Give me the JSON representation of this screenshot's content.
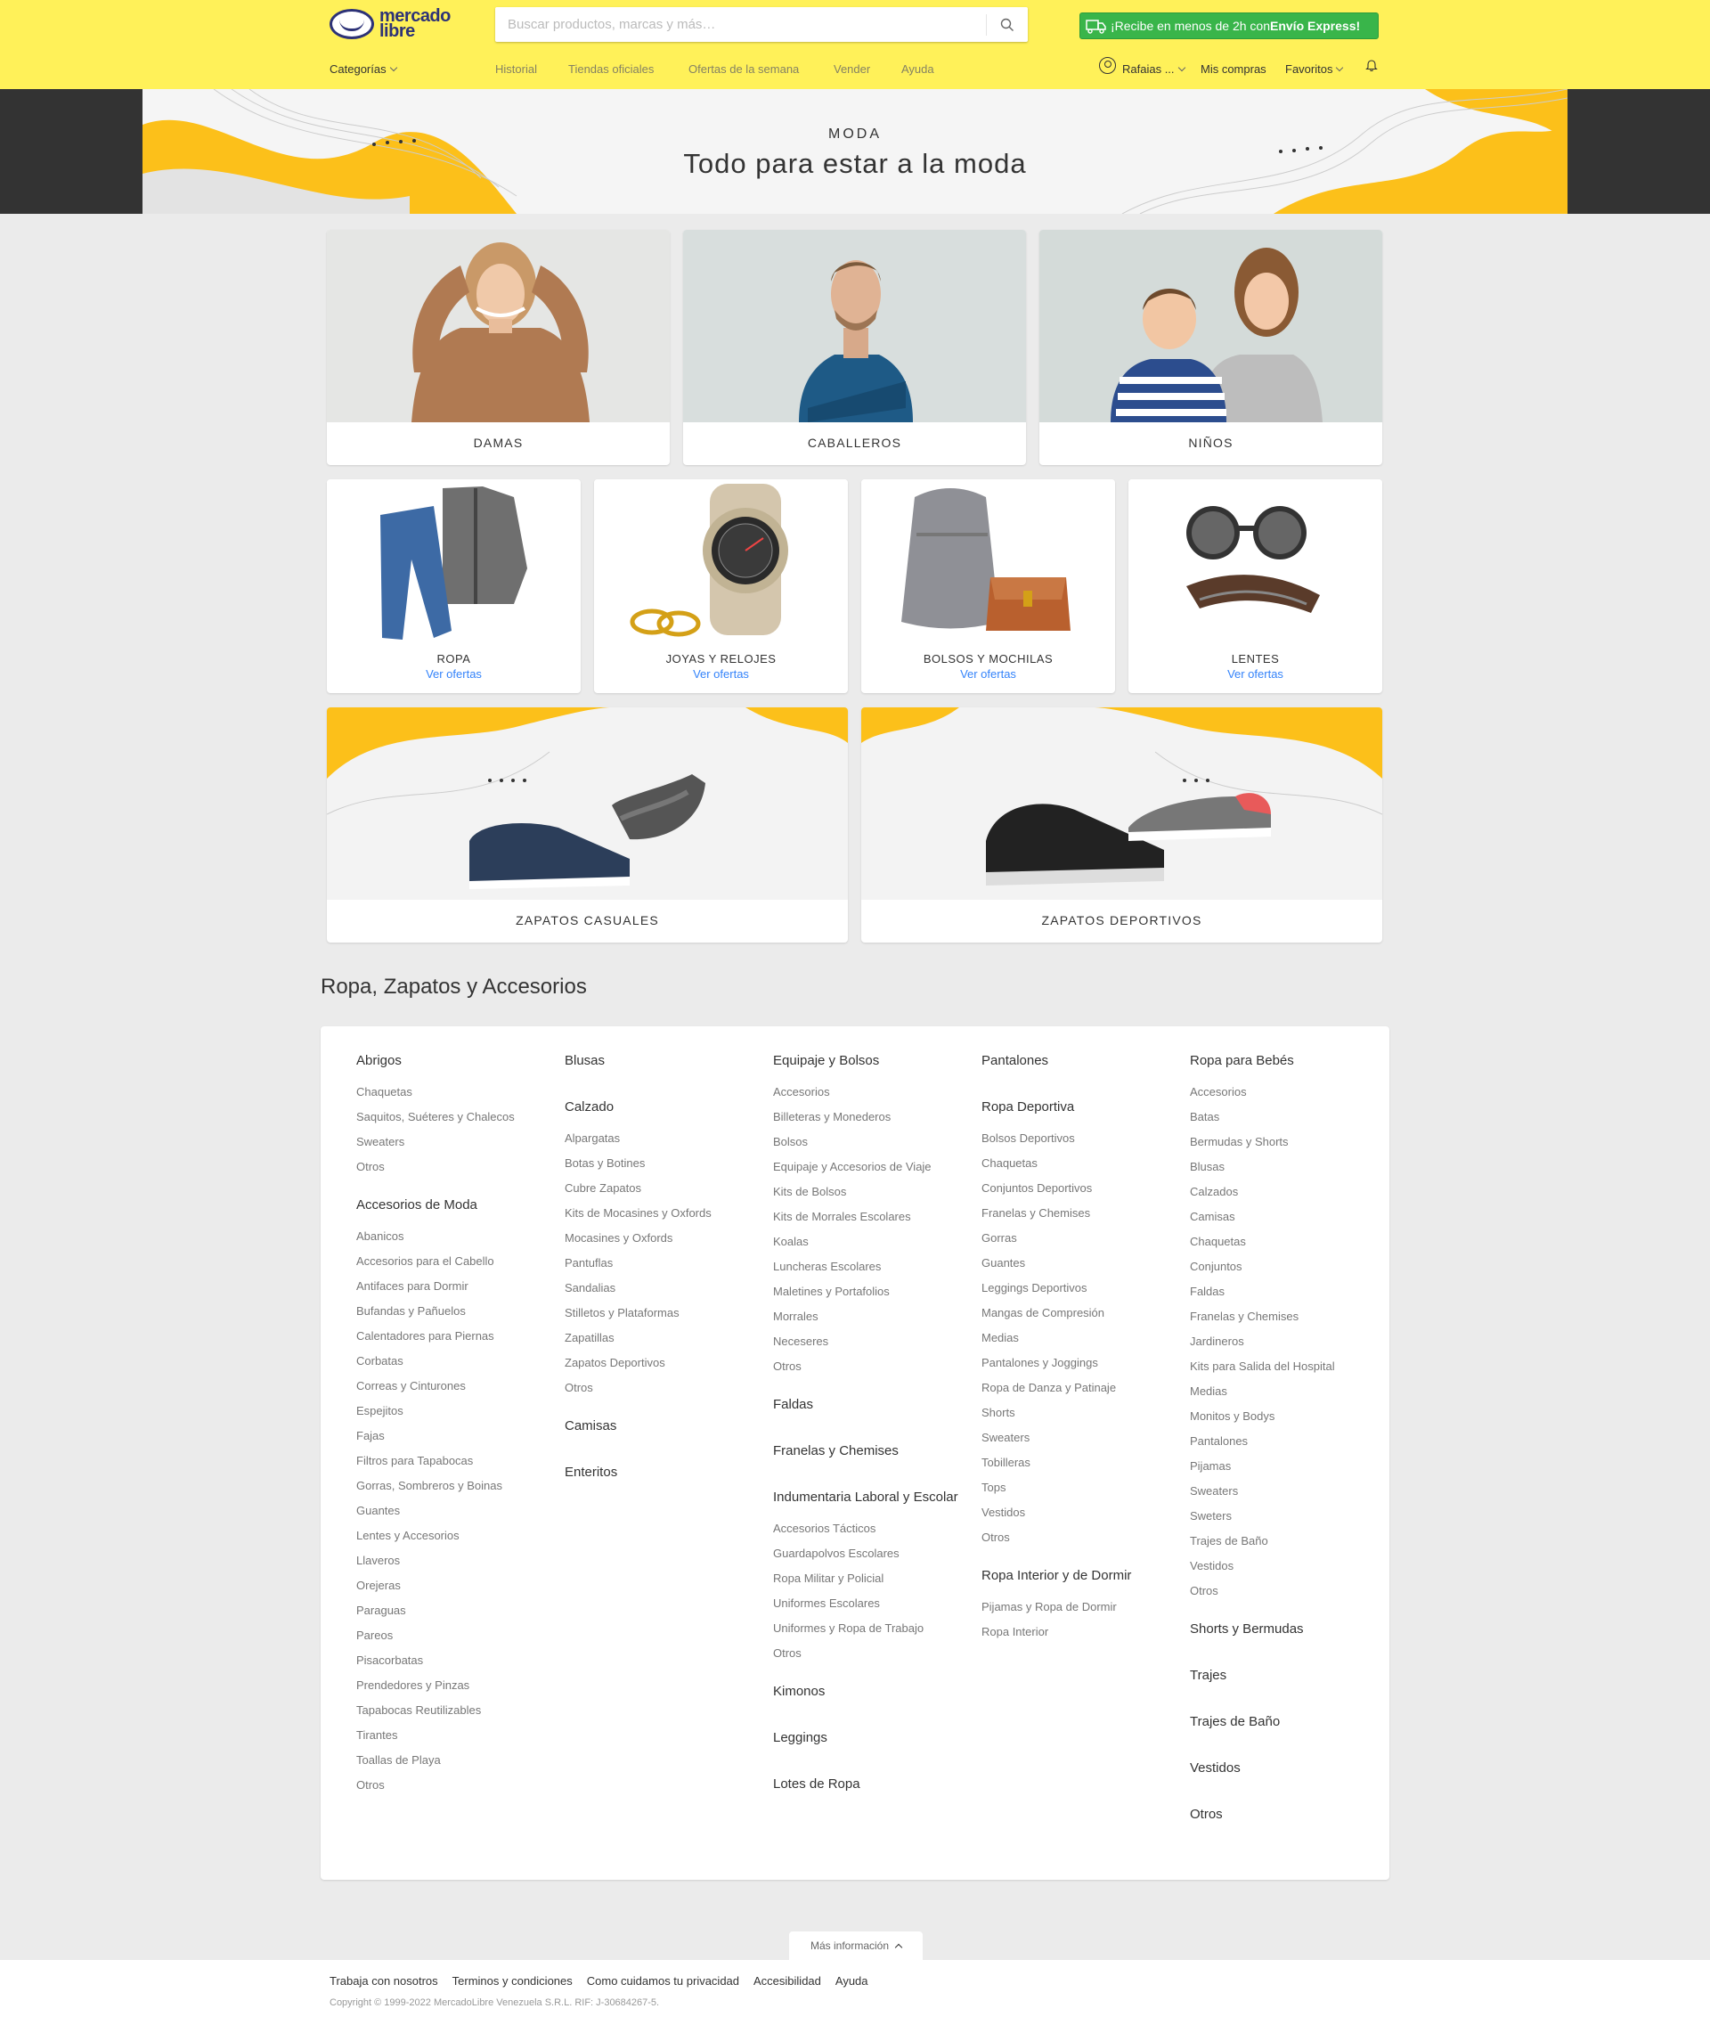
{
  "header": {
    "logo_line1": "mercado",
    "logo_line2": "libre",
    "search_placeholder": "Buscar productos, marcas y más…",
    "promo_prefix": "¡Recibe en menos de 2h con ",
    "promo_bold": "Envío Express!",
    "categories": "Categorías",
    "nav": [
      "Historial",
      "Tiendas oficiales",
      "Ofertas de la semana",
      "Vender",
      "Ayuda"
    ],
    "user": "Rafaias ...",
    "purchases": "Mis compras",
    "favorites": "Favoritos"
  },
  "hero": {
    "kicker": "MODA",
    "title": "Todo para estar a la moda"
  },
  "big_cards": [
    "DAMAS",
    "CABALLEROS",
    "NIÑOS"
  ],
  "mid_cards": [
    {
      "label": "ROPA",
      "link": "Ver ofertas"
    },
    {
      "label": "JOYAS Y RELOJES",
      "link": "Ver ofertas"
    },
    {
      "label": "BOLSOS Y MOCHILAS",
      "link": "Ver ofertas"
    },
    {
      "label": "LENTES",
      "link": "Ver ofertas"
    }
  ],
  "shoe_cards": [
    "ZAPATOS CASUALES",
    "ZAPATOS DEPORTIVOS"
  ],
  "section_title": "Ropa, Zapatos y Accesorios",
  "columns": [
    [
      {
        "title": "Abrigos",
        "items": [
          "Chaquetas",
          "Saquitos, Suéteres y Chalecos",
          "Sweaters",
          "Otros"
        ]
      },
      {
        "title": "Accesorios de Moda",
        "items": [
          "Abanicos",
          "Accesorios para el Cabello",
          "Antifaces para Dormir",
          "Bufandas y Pañuelos",
          "Calentadores para Piernas",
          "Corbatas",
          "Correas y Cinturones",
          "Espejitos",
          "Fajas",
          "Filtros para Tapabocas",
          "Gorras, Sombreros y Boinas",
          "Guantes",
          "Lentes y Accesorios",
          "Llaveros",
          "Orejeras",
          "Paraguas",
          "Pareos",
          "Pisacorbatas",
          "Prendedores y Pinzas",
          "Tapabocas Reutilizables",
          "Tirantes",
          "Toallas de Playa",
          "Otros"
        ]
      }
    ],
    [
      {
        "title": "Blusas",
        "items": []
      },
      {
        "title": "Calzado",
        "items": [
          "Alpargatas",
          "Botas y Botines",
          "Cubre Zapatos",
          "Kits de Mocasines y Oxfords",
          "Mocasines y Oxfords",
          "Pantuflas",
          "Sandalias",
          "Stilletos y Plataformas",
          "Zapatillas",
          "Zapatos Deportivos",
          "Otros"
        ]
      },
      {
        "title": "Camisas",
        "items": []
      },
      {
        "title": "Enteritos",
        "items": []
      }
    ],
    [
      {
        "title": "Equipaje y Bolsos",
        "items": [
          "Accesorios",
          "Billeteras y Monederos",
          "Bolsos",
          "Equipaje y Accesorios de Viaje",
          "Kits de Bolsos",
          "Kits de Morrales Escolares",
          "Koalas",
          "Luncheras Escolares",
          "Maletines y Portafolios",
          "Morrales",
          "Neceseres",
          "Otros"
        ]
      },
      {
        "title": "Faldas",
        "items": []
      },
      {
        "title": "Franelas y Chemises",
        "items": []
      },
      {
        "title": "Indumentaria Laboral y Escolar",
        "items": [
          "Accesorios Tácticos",
          "Guardapolvos Escolares",
          "Ropa Militar y Policial",
          "Uniformes Escolares",
          "Uniformes y Ropa de Trabajo",
          "Otros"
        ]
      },
      {
        "title": "Kimonos",
        "items": []
      },
      {
        "title": "Leggings",
        "items": []
      },
      {
        "title": "Lotes de Ropa",
        "items": []
      }
    ],
    [
      {
        "title": "Pantalones",
        "items": []
      },
      {
        "title": "Ropa Deportiva",
        "items": [
          "Bolsos Deportivos",
          "Chaquetas",
          "Conjuntos Deportivos",
          "Franelas y Chemises",
          "Gorras",
          "Guantes",
          "Leggings Deportivos",
          "Mangas de Compresión",
          "Medias",
          "Pantalones y Joggings",
          "Ropa de Danza y Patinaje",
          "Shorts",
          "Sweaters",
          "Tobilleras",
          "Tops",
          "Vestidos",
          "Otros"
        ]
      },
      {
        "title": "Ropa Interior y de Dormir",
        "items": [
          "Pijamas y Ropa de Dormir",
          "Ropa Interior"
        ]
      }
    ],
    [
      {
        "title": "Ropa para Bebés",
        "items": [
          "Accesorios",
          "Batas",
          "Bermudas y Shorts",
          "Blusas",
          "Calzados",
          "Camisas",
          "Chaquetas",
          "Conjuntos",
          "Faldas",
          "Franelas y Chemises",
          "Jardineros",
          "Kits para Salida del Hospital",
          "Medias",
          "Monitos y Bodys",
          "Pantalones",
          "Pijamas",
          "Sweaters",
          "Sweters",
          "Trajes de Baño",
          "Vestidos",
          "Otros"
        ]
      },
      {
        "title": "Shorts y Bermudas",
        "items": []
      },
      {
        "title": "Trajes",
        "items": []
      },
      {
        "title": "Trajes de Baño",
        "items": []
      },
      {
        "title": "Vestidos",
        "items": []
      },
      {
        "title": "Otros",
        "items": []
      }
    ]
  ],
  "footer": {
    "more": "Más información",
    "links": [
      "Trabaja con nosotros",
      "Terminos y condiciones",
      "Como cuidamos tu privacidad",
      "Accesibilidad",
      "Ayuda"
    ],
    "copyright": "Copyright © 1999-2022 MercadoLibre Venezuela S.R.L. RIF: J-30684267-5."
  },
  "colors": {
    "header": "#fff159",
    "link": "#3483fa",
    "promo": "#39b54a",
    "accent": "#fcc01a"
  }
}
